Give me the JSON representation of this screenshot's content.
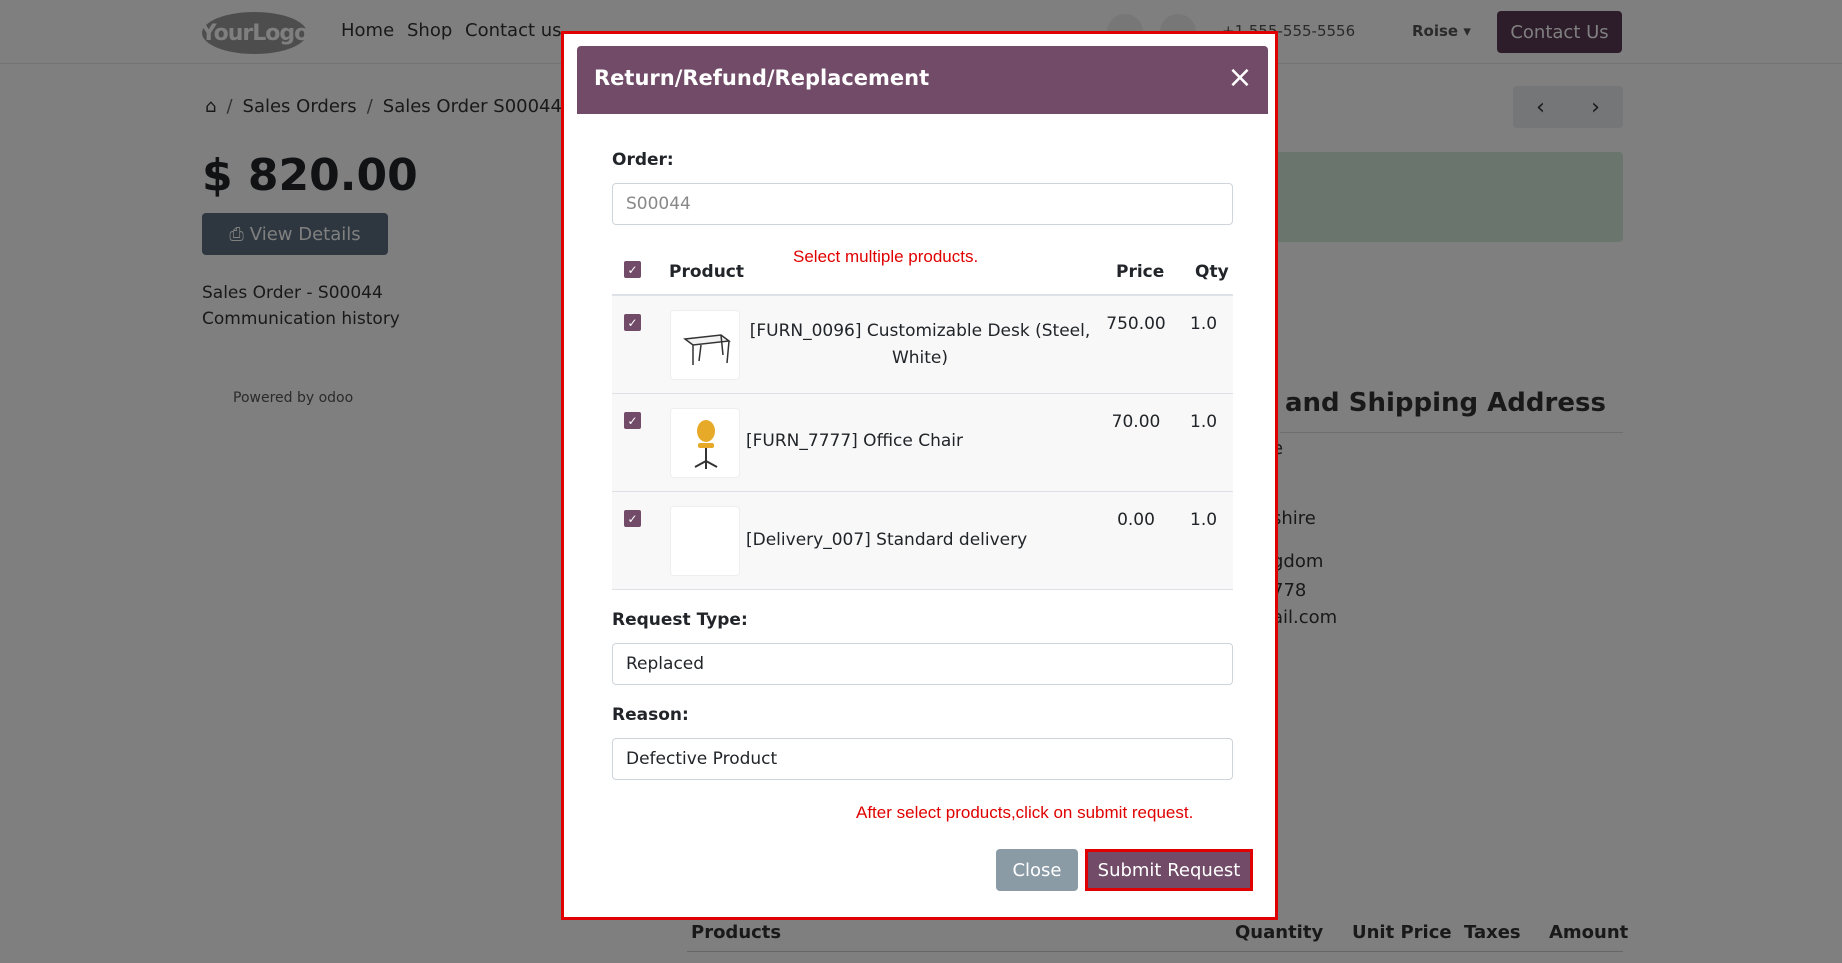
{
  "nav": {
    "logo": "YourLogo",
    "links": [
      "Home",
      "Shop",
      "Contact us"
    ],
    "phone": "+1 555-555-5556",
    "user": "Roise",
    "contact_button": "Contact Us"
  },
  "page": {
    "breadcrumb": [
      "Sales Orders",
      "Sales Order S00044"
    ],
    "amount": "$ 820.00",
    "view_details": "View Details",
    "sales_order": "Sales Order - S00044",
    "communication": "Communication history",
    "powered_by": "Powered by",
    "powered_brand": "odoo",
    "address_title": "and Shipping Address",
    "address_lines": [
      "e",
      "shire",
      "gdom",
      "778",
      "ail.com"
    ],
    "products_table_headers": [
      "Products",
      "Quantity",
      "Unit Price",
      "Taxes",
      "Amount"
    ]
  },
  "modal": {
    "title": "Return/Refund/Replacement",
    "order_label": "Order:",
    "order_placeholder": "S00044",
    "table_headers": {
      "product": "Product",
      "price": "Price",
      "qty": "Qty"
    },
    "rows": [
      {
        "name": "[FURN_0096] Customizable Desk (Steel, White)",
        "price": "750.00",
        "qty": "1.0"
      },
      {
        "name": "[FURN_7777] Office Chair",
        "price": "70.00",
        "qty": "1.0"
      },
      {
        "name": "[Delivery_007] Standard delivery",
        "price": "0.00",
        "qty": "1.0"
      }
    ],
    "request_type_label": "Request Type:",
    "request_type_value": "Replaced",
    "reason_label": "Reason:",
    "reason_value": "Defective Product",
    "close_button": "Close",
    "submit_button": "Submit Request"
  },
  "annotations": {
    "select_hint": "Select multiple products.",
    "submit_hint": "After select products,click on submit request."
  },
  "colors": {
    "brand": "#714b67",
    "annotation": "#e00000"
  }
}
